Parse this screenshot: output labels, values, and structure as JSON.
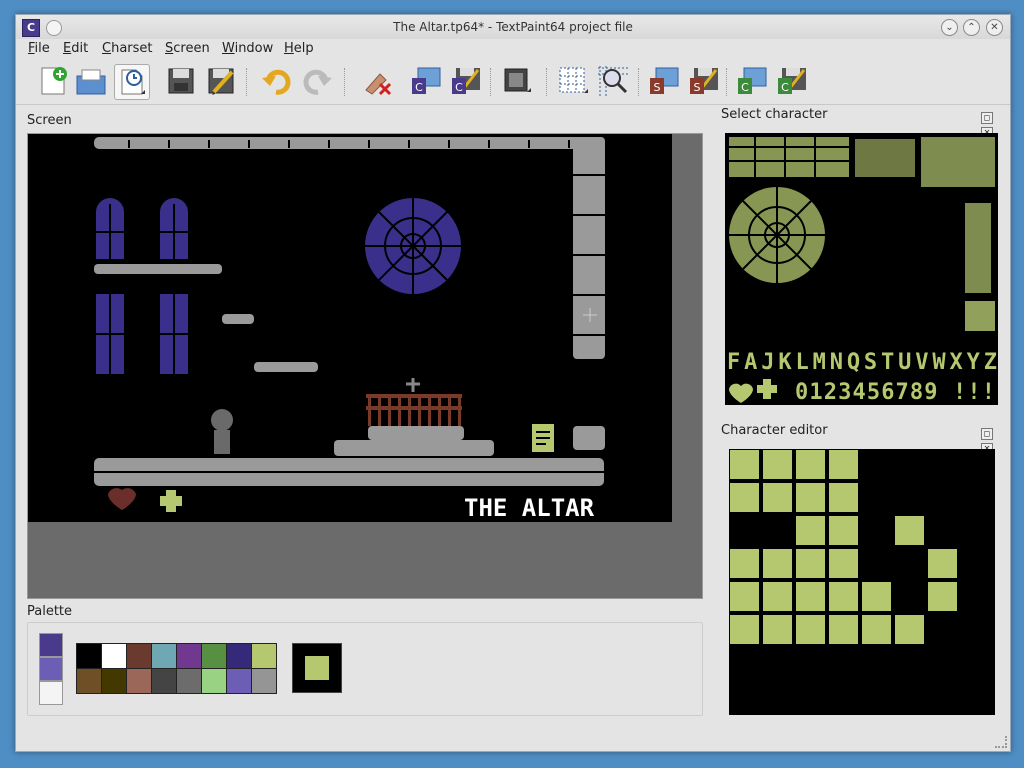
{
  "window": {
    "title": "The Altar.tp64* - TextPaint64 project file",
    "app_icon_glyph": "C",
    "controls": [
      "minimize",
      "maximize",
      "close"
    ]
  },
  "menu": {
    "items": [
      "File",
      "Edit",
      "Charset",
      "Screen",
      "Window",
      "Help"
    ]
  },
  "toolbar": {
    "buttons": [
      "new-project",
      "open-project",
      "recent-projects",
      "save",
      "save-as",
      "undo",
      "redo",
      "clear",
      "import-charset",
      "export-charset",
      "charset-settings",
      "toggle-grid",
      "zoom",
      "import-screen",
      "export-screen",
      "import-color",
      "export-color"
    ]
  },
  "panels": {
    "screen_title": "Screen",
    "palette_title": "Palette",
    "select_char_title": "Select character",
    "char_editor_title": "Character editor"
  },
  "screen": {
    "room_label": "THE ALTAR"
  },
  "charset_preview": {
    "row1": "FAJKLMNQSTUVWXYZ",
    "row2": "0123456789 !!!"
  },
  "palette": {
    "colors_row1": [
      "#000000",
      "#ffffff",
      "#6a3a2f",
      "#6fa8b2",
      "#70388f",
      "#578f43",
      "#352a79",
      "#b5c870"
    ],
    "colors_row2": [
      "#6f4f25",
      "#433900",
      "#9a6759",
      "#444444",
      "#6c6c6c",
      "#9ad284",
      "#6c5eb5",
      "#959595"
    ],
    "selected_color": "#b5c870",
    "background_color": "#000000"
  },
  "char_editor": {
    "fg_color": "#b5c870",
    "bits": [
      "11110000",
      "11110000",
      "00110100",
      "11110010",
      "11111010",
      "11111100",
      "00000000",
      "00000000"
    ]
  }
}
